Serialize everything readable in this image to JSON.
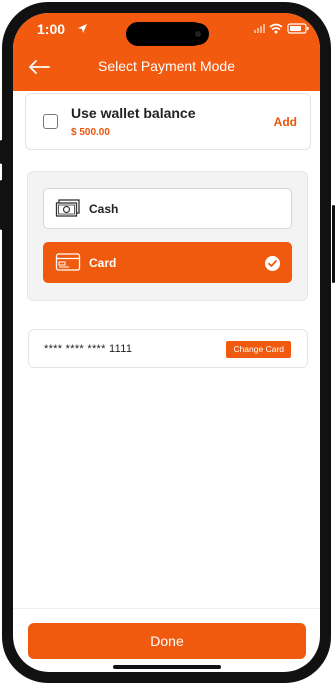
{
  "status_bar": {
    "time": "1:00"
  },
  "header": {
    "title": "Select Payment Mode",
    "back_icon": "arrow-left-icon"
  },
  "wallet": {
    "label": "Use wallet balance",
    "amount": "$ 500.00",
    "add_label": "Add",
    "checked": false
  },
  "payment_modes": {
    "options": [
      {
        "label": "Cash",
        "icon": "cash-icon",
        "selected": false
      },
      {
        "label": "Card",
        "icon": "credit-card-icon",
        "selected": true
      }
    ]
  },
  "saved_card": {
    "masked_number": "**** **** **** 1111",
    "change_label": "Change Card"
  },
  "footer": {
    "done_label": "Done"
  },
  "colors": {
    "accent": "#f05a0e",
    "background": "#ffffff",
    "panel": "#f3f3f3"
  }
}
